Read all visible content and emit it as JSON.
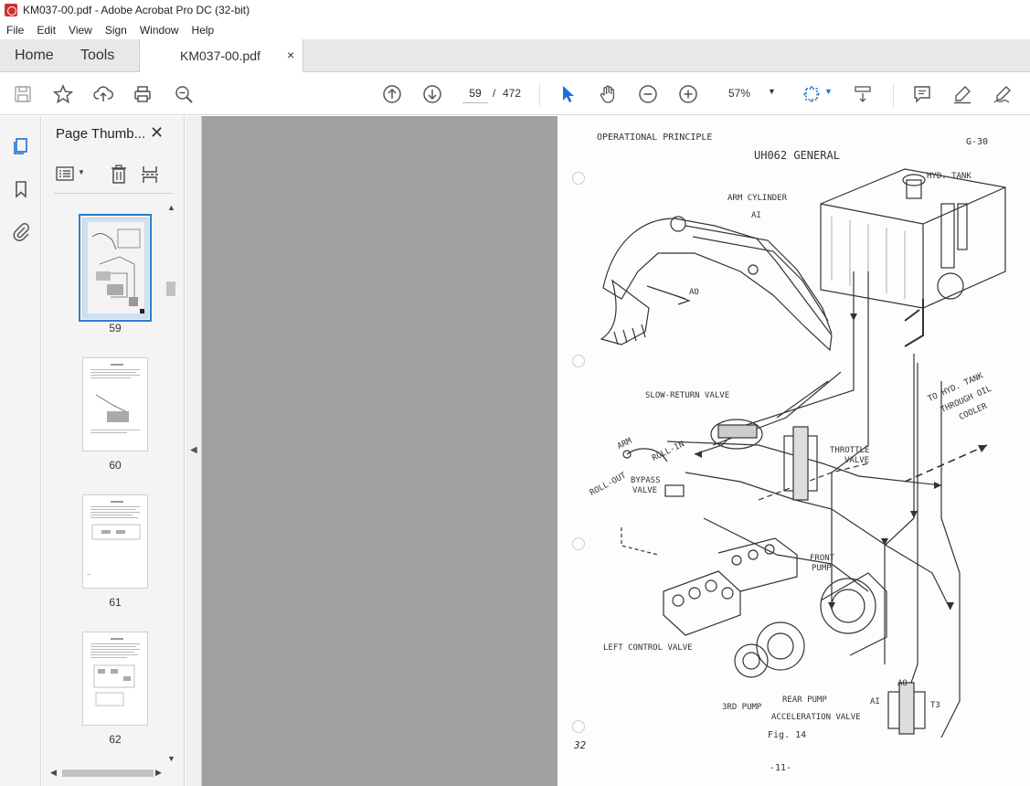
{
  "window": {
    "title": "KM037-00.pdf - Adobe Acrobat Pro DC (32-bit)"
  },
  "menu": [
    "File",
    "Edit",
    "View",
    "Sign",
    "Window",
    "Help"
  ],
  "tabs": {
    "home": "Home",
    "tools": "Tools",
    "document": "KM037-00.pdf",
    "close": "×"
  },
  "toolbar": {
    "page_current": "59",
    "page_separator": "/",
    "page_total": "472",
    "zoom": "57%",
    "icons": [
      "save-icon",
      "star-icon",
      "upload-icon",
      "print-icon",
      "zoom-search-icon",
      "page-up-icon",
      "page-down-icon",
      "select-arrow-icon",
      "hand-icon",
      "zoom-out-icon",
      "zoom-in-icon",
      "fit-page-icon",
      "scroll-mode-icon",
      "comment-icon",
      "highlight-icon",
      "sign-icon"
    ]
  },
  "panel": {
    "title": "Page Thumb...",
    "close": "✕",
    "thumbnails": [
      {
        "number": "59",
        "selected": true
      },
      {
        "number": "60",
        "selected": false
      },
      {
        "number": "61",
        "selected": false
      },
      {
        "number": "62",
        "selected": false
      }
    ]
  },
  "document": {
    "header_left": "OPERATIONAL PRINCIPLE",
    "header_right": "G-30",
    "title": "UH062 GENERAL",
    "labels": {
      "arm_cylinder": "ARM CYLINDER",
      "ai_top": "AI",
      "ao_top": "AO",
      "hyd_tank": "HYD. TANK",
      "slow_return": "SLOW-RETURN VALVE",
      "to_hyd_tank": "TO HYD. TANK",
      "through_oil": "THROUGH OIL",
      "cooler": "COOLER",
      "arm": "ARM",
      "roll_in": "ROLL-IN",
      "roll_out": "ROLL-OUT",
      "bypass": "BYPASS",
      "valve": "VALVE",
      "throttle": "THROTTLE",
      "throttle_valve": "VALVE",
      "front": "FRONT",
      "pump": "PUMP",
      "left_control": "LEFT CONTROL VALVE",
      "rear_pump": "REAR PUMP",
      "third_pump": "3RD PUMP",
      "acceleration": "ACCELERATION VALVE",
      "ai_bottom": "AI",
      "ao_bottom": "AO",
      "t3": "T3",
      "fig": "Fig. 14",
      "page_num": "-11-",
      "handwritten": "32"
    }
  }
}
